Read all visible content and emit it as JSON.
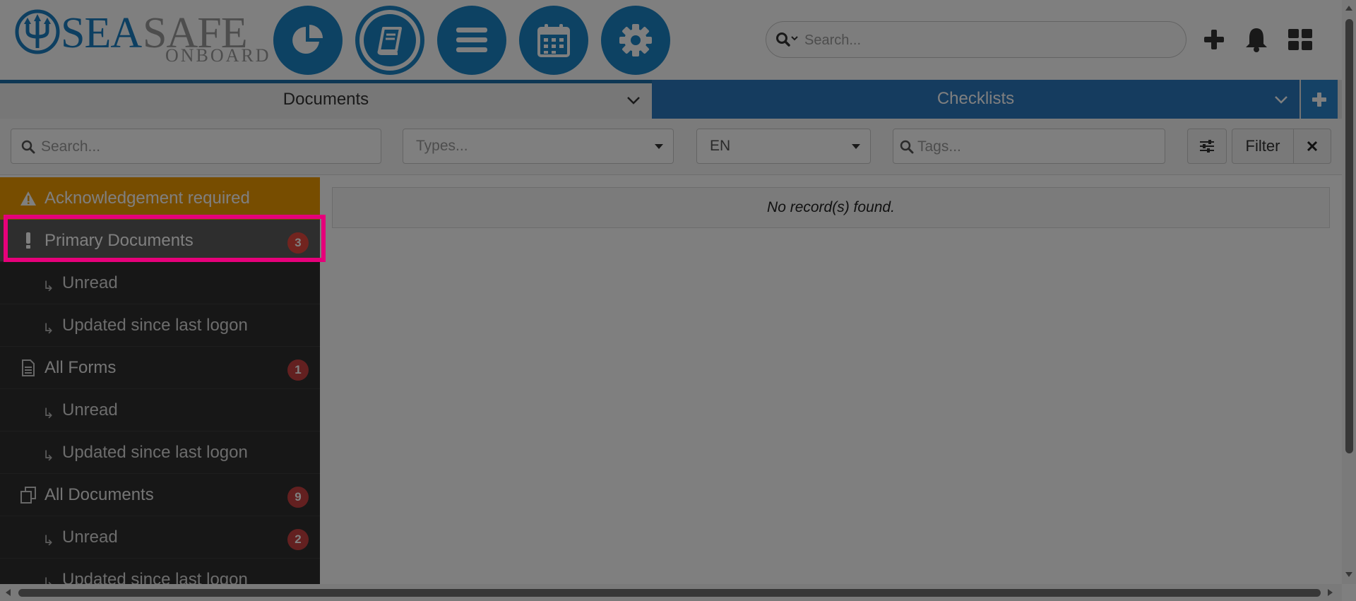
{
  "app": {
    "logo_primary": "SEA",
    "logo_secondary": "SAFE",
    "logo_sub": "ONBOARD"
  },
  "header": {
    "nav_buttons": [
      "dashboard-chart-icon",
      "book-icon",
      "menu-icon",
      "calendar-icon",
      "gear-icon"
    ],
    "active_nav": "book-icon",
    "search_placeholder": "Search...",
    "actions": [
      "plus-icon",
      "bell-icon",
      "grid-icon"
    ]
  },
  "tabs": [
    {
      "label": "Documents",
      "active": true
    },
    {
      "label": "Checklists",
      "active": false
    }
  ],
  "filters": {
    "search_placeholder": "Search...",
    "types_placeholder": "Types...",
    "language": "EN",
    "tags_placeholder": "Tags...",
    "filter_label": "Filter"
  },
  "sidebar": {
    "items": [
      {
        "label": "Acknowledgement required",
        "icon": "warning-icon",
        "kind": "alert"
      },
      {
        "label": "Primary Documents",
        "icon": "exclamation-icon",
        "badge": "3",
        "kind": "selected"
      },
      {
        "label": "Unread",
        "kind": "sub"
      },
      {
        "label": "Updated since last logon",
        "kind": "sub"
      },
      {
        "label": "All Forms",
        "icon": "form-icon",
        "badge": "1",
        "kind": "top"
      },
      {
        "label": "Unread",
        "kind": "sub"
      },
      {
        "label": "Updated since last logon",
        "kind": "sub"
      },
      {
        "label": "All Documents",
        "icon": "documents-icon",
        "badge": "9",
        "kind": "top"
      },
      {
        "label": "Unread",
        "badge": "2",
        "kind": "sub"
      },
      {
        "label": "Updated since last logon",
        "kind": "sub"
      }
    ],
    "sub_arrow": "↳"
  },
  "main": {
    "empty_message": "No record(s) found."
  },
  "colors": {
    "brand_blue": "#1a84c7",
    "alert_orange": "#ef9a00",
    "badge_red": "#c64040",
    "highlight": "#e6007a",
    "sidebar_bg": "#2f2f2f"
  }
}
